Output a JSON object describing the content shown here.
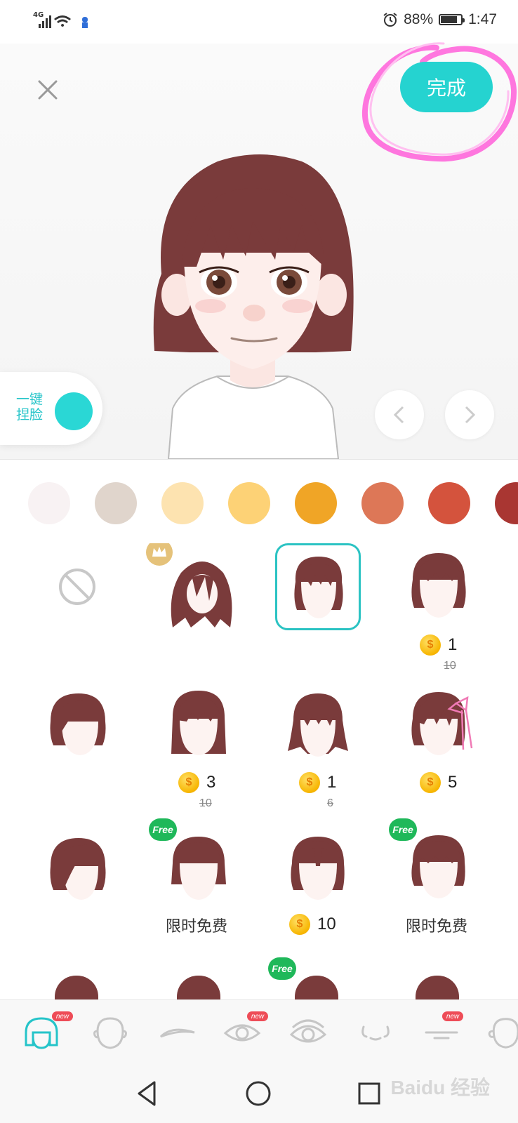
{
  "status_bar": {
    "network": "4G",
    "battery_percent": "88%",
    "battery_level": 0.88,
    "time": "1:47"
  },
  "header": {
    "done_label": "完成",
    "close_icon": "close-icon"
  },
  "pinch_face": {
    "label_line1": "一键",
    "label_line2": "捏脸"
  },
  "colors": {
    "accent": "#25d3d0",
    "hair": "#7a3b3b",
    "free_badge": "#1fb85a",
    "new_badge": "#ee4c57",
    "swatches": [
      "#f8f2f3",
      "#e0d5cc",
      "#fde3b0",
      "#fdd276",
      "#f0a526",
      "#dd7757",
      "#d4533d",
      "#a93632"
    ]
  },
  "hair_options": [
    {
      "name": "none",
      "icon": "none-icon"
    },
    {
      "name": "long-wavy",
      "badge": "crown"
    },
    {
      "name": "bob-bangs",
      "selected": true
    },
    {
      "name": "bob-short-bangs",
      "price": "1",
      "old_price": "10"
    },
    {
      "name": "side-part-bob"
    },
    {
      "name": "straight-bob",
      "price": "3",
      "old_price": "10"
    },
    {
      "name": "layered-bob",
      "price": "1",
      "old_price": "6"
    },
    {
      "name": "bob-ribbon",
      "price": "5"
    },
    {
      "name": "side-swept-bob"
    },
    {
      "name": "blunt-bob",
      "badge": "Free",
      "free_text": "限时免费"
    },
    {
      "name": "center-part-bob",
      "price": "10"
    },
    {
      "name": "choppy-bob",
      "badge": "Free",
      "free_text": "限时免费"
    }
  ],
  "tabs": [
    {
      "name": "hair",
      "icon": "hair-icon",
      "active": true,
      "badge": "new"
    },
    {
      "name": "face",
      "icon": "face-icon"
    },
    {
      "name": "eyebrow",
      "icon": "eyebrow-icon"
    },
    {
      "name": "eye",
      "icon": "eye-icon",
      "badge": "new"
    },
    {
      "name": "eye-alt",
      "icon": "eye-detail-icon"
    },
    {
      "name": "nose",
      "icon": "nose-icon"
    },
    {
      "name": "mouth",
      "icon": "mouth-icon",
      "badge": "new"
    },
    {
      "name": "ear",
      "icon": "ear-icon"
    }
  ],
  "watermark": "Baidu 经验",
  "free_badge_label": "Free",
  "new_badge_label": "new"
}
